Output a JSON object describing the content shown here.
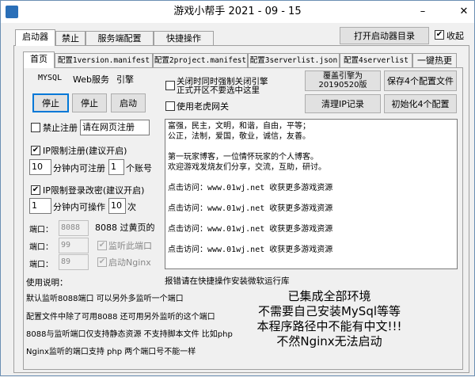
{
  "window": {
    "title": "游戏小帮手 2021 - 09 - 15"
  },
  "main_tabs": [
    "启动器",
    "禁止",
    "服务端配置",
    "快捷操作"
  ],
  "top_right": {
    "open_dir": "打开启动器目录",
    "collapse_label": "收起",
    "collapse_checked": "✔"
  },
  "sub_tabs": [
    "首页",
    "配置1version.manifest",
    "配置2project.manifest",
    "配置3serverlist.json",
    "配置4serverlist",
    "一键热更"
  ],
  "services": {
    "mysql": "MYSQL",
    "web": "Web服务",
    "engine": "引擎"
  },
  "service_buttons": [
    "停止",
    "停止",
    "启动"
  ],
  "ban_register": {
    "label": "禁止注册",
    "value": "请在网页注册"
  },
  "ip_register": {
    "label": "IP限制注册(建议开启)",
    "minutes": "10",
    "text1": "分钟内可注册",
    "count": "1",
    "text2": "个账号"
  },
  "ip_login": {
    "label": "IP限制登录改密(建议开启)",
    "minutes": "1",
    "text1": "分钟内可操作",
    "count": "10",
    "text2": "次"
  },
  "ports": {
    "label": "端口：",
    "row1_value": "8088",
    "row1_note": "8088 过黄页的",
    "row2_value": "99",
    "row2_check": "监听此端口",
    "row3_value": "89",
    "row3_check": "启动Nginx"
  },
  "options": {
    "close_on_exit": "关闭时同时强制关闭引擎",
    "close_on_exit2": "正式开区不要选中这里",
    "use_tiger": "使用老虎网关"
  },
  "right_buttons": {
    "override_engine_1": "覆盖引擎为",
    "override_engine_2": "20190520版",
    "save_config": "保存4个配置文件",
    "clear_ip": "清理IP记录",
    "init_config": "初始化4个配置"
  },
  "info_text": [
    "富强，民主，文明，和谐，自由，平等；",
    "公正，法制，爱国，敬业，诚信，友善。",
    "",
    "第一玩家博客，一位情怀玩家的个人博客。",
    "欢迎游戏发烧友们分享，交流，互助，研讨。",
    "",
    "点击访问：www.01wj.net    收获更多游戏资源",
    "",
    "点击访问：www.01wj.net    收获更多游戏资源",
    "",
    "点击访问：www.01wj.net    收获更多游戏资源",
    "",
    "点击访问：www.01wj.net    收获更多游戏资源"
  ],
  "error_hint": "报错请在快捷操作安装微软运行库",
  "usage": {
    "title": "使用说明：",
    "lines": [
      "默认监听8088端口  可以另外多监听一个端口",
      "配置文件中除了可用8088  还可用另外监听的这个端口",
      "8088与监听端口仅支持静态资源  不支持脚本文件  比如php",
      "Nginx监听的端口支持  php  两个端口号不能一样"
    ]
  },
  "notice": [
    "已集成全部环境",
    "不需要自己安装MySql等等",
    "本程序路径中不能有中文!!!",
    "不然Nginx无法启动"
  ],
  "colors": {
    "accent": "#0078d7",
    "window_border": "#6b8fb3"
  }
}
